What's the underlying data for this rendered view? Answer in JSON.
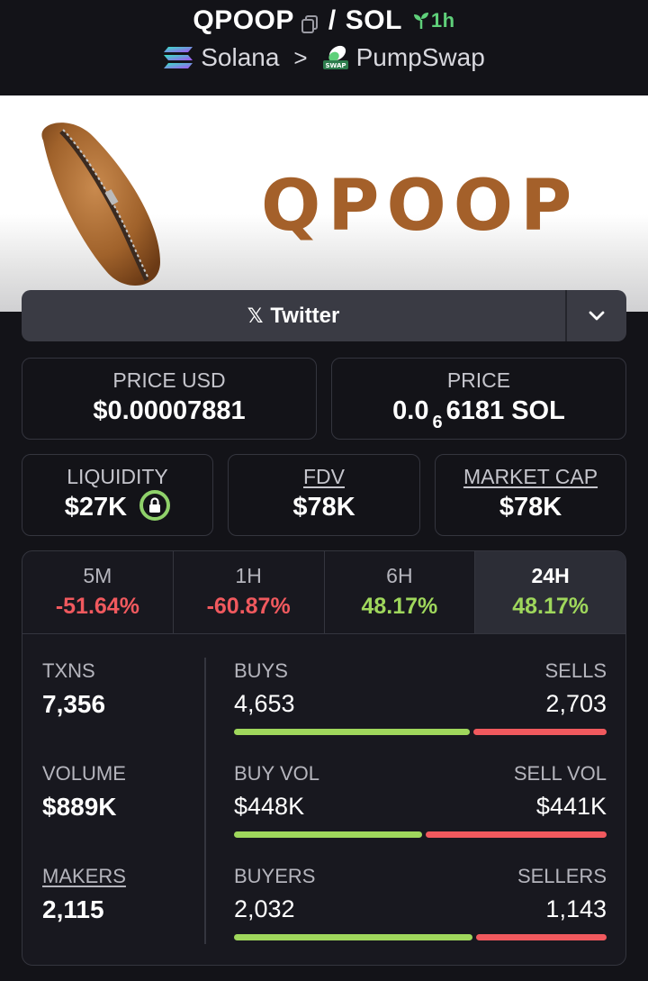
{
  "header": {
    "token": "QPOOP",
    "slash": "/",
    "quote": "SOL",
    "age": "1h",
    "chain": "Solana",
    "separator": ">",
    "dex": "PumpSwap",
    "dex_badge": "SWAP"
  },
  "banner": {
    "text": "QPOOP"
  },
  "social": {
    "twitter_label": "Twitter"
  },
  "stats": {
    "price_usd_label": "PRICE USD",
    "price_usd": "$0.00007881",
    "price_label": "PRICE",
    "price_prefix": "0.0",
    "price_zeros": "6",
    "price_suffix": "6181 SOL",
    "liquidity_label": "LIQUIDITY",
    "liquidity": "$27K",
    "fdv_label": "FDV",
    "fdv": "$78K",
    "mcap_label": "MARKET CAP",
    "mcap": "$78K"
  },
  "changes": [
    {
      "label": "5M",
      "value": "-51.64%"
    },
    {
      "label": "1H",
      "value": "-60.87%"
    },
    {
      "label": "6H",
      "value": "48.17%"
    },
    {
      "label": "24H",
      "value": "48.17%"
    }
  ],
  "active_tab": "24H",
  "txns": {
    "txns_label": "TXNS",
    "txns": "7,356",
    "volume_label": "VOLUME",
    "volume": "$889K",
    "makers_label": "MAKERS",
    "makers": "2,115"
  },
  "splits": {
    "buys_label": "BUYS",
    "buys": "4,653",
    "sells_label": "SELLS",
    "sells": "2,703",
    "buys_ratio": 0.633,
    "buyvol_label": "BUY VOL",
    "buyvol": "$448K",
    "sellvol_label": "SELL VOL",
    "sellvol": "$441K",
    "buyvol_ratio": 0.504,
    "buyers_label": "BUYERS",
    "buyers": "2,032",
    "sellers_label": "SELLERS",
    "sellers": "1,143",
    "buyers_ratio": 0.64
  },
  "colors": {
    "positive": "#9fd75c",
    "negative": "#f0595e",
    "age": "#5fd07a",
    "banner_text": "#a4602a"
  }
}
